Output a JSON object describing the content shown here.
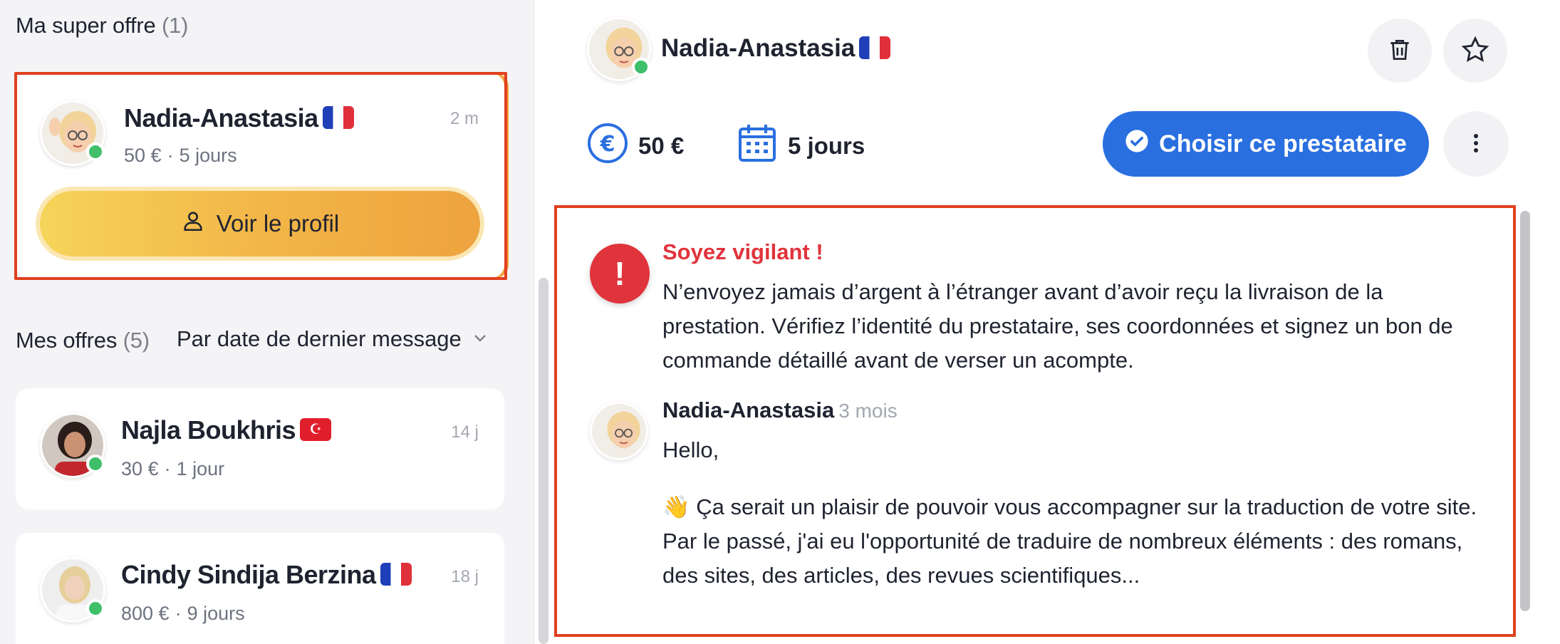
{
  "super_offer": {
    "title": "Ma super offre",
    "count": "(1)",
    "card": {
      "name": "Nadia-Anastasia",
      "price": "50 €",
      "duration": "5 jours",
      "time": "2 m",
      "button": "Voir le profil"
    }
  },
  "offers": {
    "title": "Mes offres",
    "count": "(5)",
    "sort_label": "Par date de dernier message",
    "items": [
      {
        "name": "Najla Boukhris",
        "price": "30 €",
        "duration": "1 jour",
        "time": "14 j",
        "flag": "tunisia-flag"
      },
      {
        "name": "Cindy Sindija Berzina",
        "price": "800 €",
        "duration": "9 jours",
        "time": "18 j",
        "flag": "france-flag"
      }
    ]
  },
  "detail": {
    "name": "Nadia-Anastasia",
    "price": "50 €",
    "duration": "5 jours",
    "choose_button": "Choisir ce prestataire",
    "warning": {
      "title": "Soyez vigilant !",
      "body": "N’envoyez jamais d’argent à l’étranger avant d’avoir reçu la livraison de la prestation. Vérifiez l’identité du prestataire, ses coordonnées et signez un bon de commande détaillé avant de verser un acompte."
    },
    "message": {
      "author": "Nadia-Anastasia",
      "ago": "3 mois",
      "greeting": "Hello,",
      "line1": "👋 Ça serait un plaisir de pouvoir vous accompagner sur la traduction de votre site.",
      "line2": "Par le passé, j'ai eu l'opportunité de traduire de nombreux éléments : des romans, des sites, des articles, des revues scientifiques..."
    }
  },
  "colors": {
    "primary": "#2a6fe0",
    "warning": "#e0343c",
    "online": "#3fbf6a",
    "highlight_border": "#e0401f",
    "profile_button_gradient_start": "#f6d45a",
    "profile_button_gradient_end": "#eea33f"
  },
  "dot": "·"
}
